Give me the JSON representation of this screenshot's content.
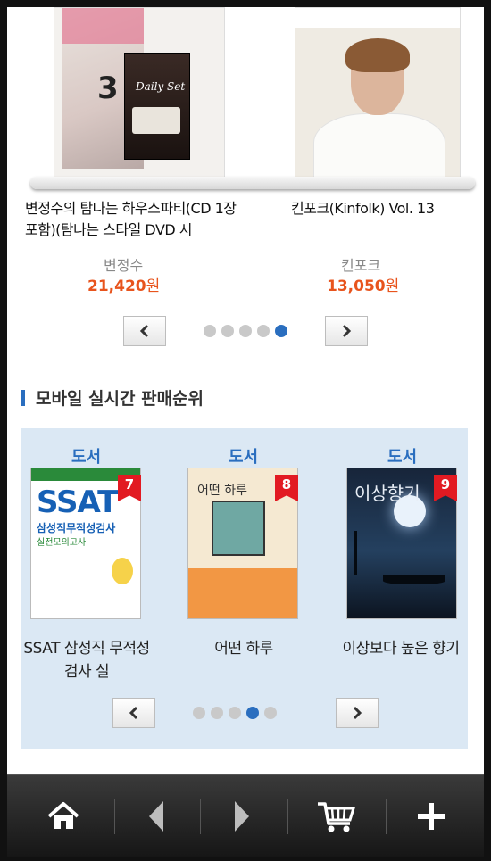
{
  "top_carousel": {
    "products": [
      {
        "title": "변정수의 탐나는 하우스파티(CD 1장포함)(탐나는 스타일 DVD 시",
        "author": "변정수",
        "price": "21,420",
        "currency": "원"
      },
      {
        "title": "킨포크(Kinfolk) Vol. 13",
        "author": "킨포크",
        "price": "13,050",
        "currency": "원"
      }
    ],
    "cover1_text": {
      "num": "3",
      "dvd_title": "Daily Set"
    },
    "cover2_text": {},
    "page_dots": 5,
    "active_dot": 5
  },
  "ranking": {
    "section_title": "모바일 실시간 판매순위",
    "items": [
      {
        "category": "도서",
        "rank": "7",
        "title": "SSAT 삼성직 무적성검사 실",
        "cover": {
          "main": "SSAT",
          "sub": "삼성직무적성검사",
          "sub2": "실전모의고사"
        }
      },
      {
        "category": "도서",
        "rank": "8",
        "title": "어떤 하루",
        "cover": {
          "main": "어떤 하루"
        }
      },
      {
        "category": "도서",
        "rank": "9",
        "title": "이상보다 높은 향기",
        "cover": {
          "main": "이상향기"
        }
      }
    ],
    "page_dots": 5,
    "active_dot": 4
  },
  "bottom_nav": {
    "items": [
      "home-icon",
      "back-icon",
      "forward-icon",
      "cart-icon",
      "plus-icon"
    ]
  }
}
